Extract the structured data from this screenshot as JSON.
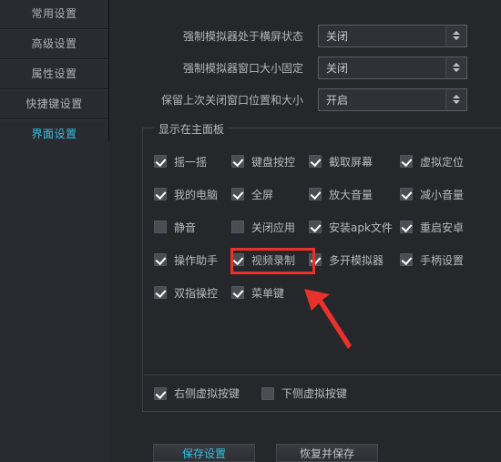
{
  "sidebar": {
    "items": [
      {
        "label": "常用设置",
        "active": false
      },
      {
        "label": "高级设置",
        "active": false
      },
      {
        "label": "属性设置",
        "active": false
      },
      {
        "label": "快捷键设置",
        "active": false
      },
      {
        "label": "界面设置",
        "active": true
      }
    ]
  },
  "settings_rows": [
    {
      "label": "强制模拟器处于横屏状态",
      "value": "关闭"
    },
    {
      "label": "强制模拟器窗口大小固定",
      "value": "关闭"
    },
    {
      "label": "保留上次关闭窗口位置和大小",
      "value": "开启"
    }
  ],
  "group": {
    "title": "显示在主面板",
    "checkbox_rows": [
      [
        {
          "label": "摇一摇",
          "checked": true
        },
        {
          "label": "键盘按控",
          "checked": true
        },
        {
          "label": "截取屏幕",
          "checked": true
        },
        {
          "label": "虚拟定位",
          "checked": true
        }
      ],
      [
        {
          "label": "我的电脑",
          "checked": true
        },
        {
          "label": "全屏",
          "checked": true
        },
        {
          "label": "放大音量",
          "checked": true
        },
        {
          "label": "减小音量",
          "checked": true
        }
      ],
      [
        {
          "label": "静音",
          "checked": false
        },
        {
          "label": "关闭应用",
          "checked": false
        },
        {
          "label": "安装apk文件",
          "checked": true
        },
        {
          "label": "重启安卓",
          "checked": true
        }
      ],
      [
        {
          "label": "操作助手",
          "checked": true
        },
        {
          "label": "视频录制",
          "checked": true
        },
        {
          "label": "多开模拟器",
          "checked": true
        },
        {
          "label": "手柄设置",
          "checked": true
        }
      ],
      [
        {
          "label": "双指操控",
          "checked": true
        },
        {
          "label": "菜单键",
          "checked": true
        }
      ]
    ],
    "bottom_row": [
      {
        "label": "右侧虚拟按键",
        "checked": true
      },
      {
        "label": "下侧虚拟按键",
        "checked": false
      }
    ]
  },
  "buttons": {
    "save": "保存设置",
    "restore": "恢复并保存"
  },
  "annotation": {
    "highlight_color": "#e8312a",
    "accent_color": "#2fc3e3",
    "highlight_target": "视频录制"
  }
}
